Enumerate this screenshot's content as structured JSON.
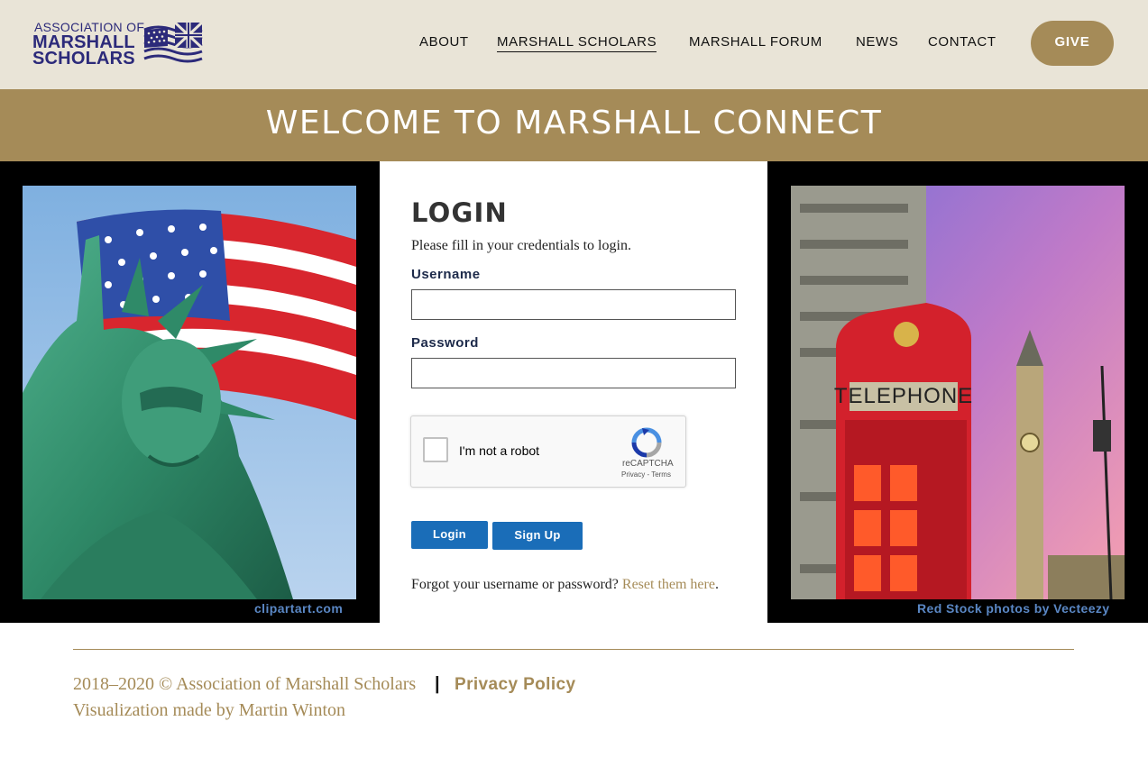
{
  "header": {
    "logo": {
      "line1": "ASSOCIATION OF",
      "line2": "MARSHALL",
      "line3": "SCHOLARS"
    },
    "nav": [
      {
        "label": "ABOUT"
      },
      {
        "label": "MARSHALL SCHOLARS",
        "active": true
      },
      {
        "label": "MARSHALL FORUM"
      },
      {
        "label": "NEWS"
      },
      {
        "label": "CONTACT"
      }
    ],
    "give_label": "GIVE"
  },
  "banner": {
    "title": "WELCOME TO MARSHALL CONNECT"
  },
  "left_photo": {
    "icon": "statue-of-liberty-photo",
    "credit": "clipartart.com"
  },
  "right_photo": {
    "icon": "london-phone-booth-photo",
    "credit": "Red Stock photos by Vecteezy"
  },
  "login": {
    "title": "LOGIN",
    "description": "Please fill in your credentials to login.",
    "username_label": "Username",
    "username_value": "",
    "password_label": "Password",
    "password_value": "",
    "captcha": {
      "text": "I'm not a robot",
      "brand": "reCAPTCHA",
      "links": "Privacy - Terms"
    },
    "login_button": "Login",
    "signup_button": "Sign Up",
    "forgot_text": "Forgot your username or password?",
    "forgot_link": "Reset them here",
    "forgot_end": "."
  },
  "footer": {
    "copyright": "2018–2020 © Association of Marshall Scholars",
    "separator": "|",
    "privacy": "Privacy Policy",
    "credit": "Visualization made by Martin Winton"
  },
  "colors": {
    "header_bg": "#e9e4d7",
    "gold": "#a58b58",
    "navy": "#2c2a7a",
    "button_blue": "#1a6db8",
    "credit_blue": "#5a87c4"
  }
}
